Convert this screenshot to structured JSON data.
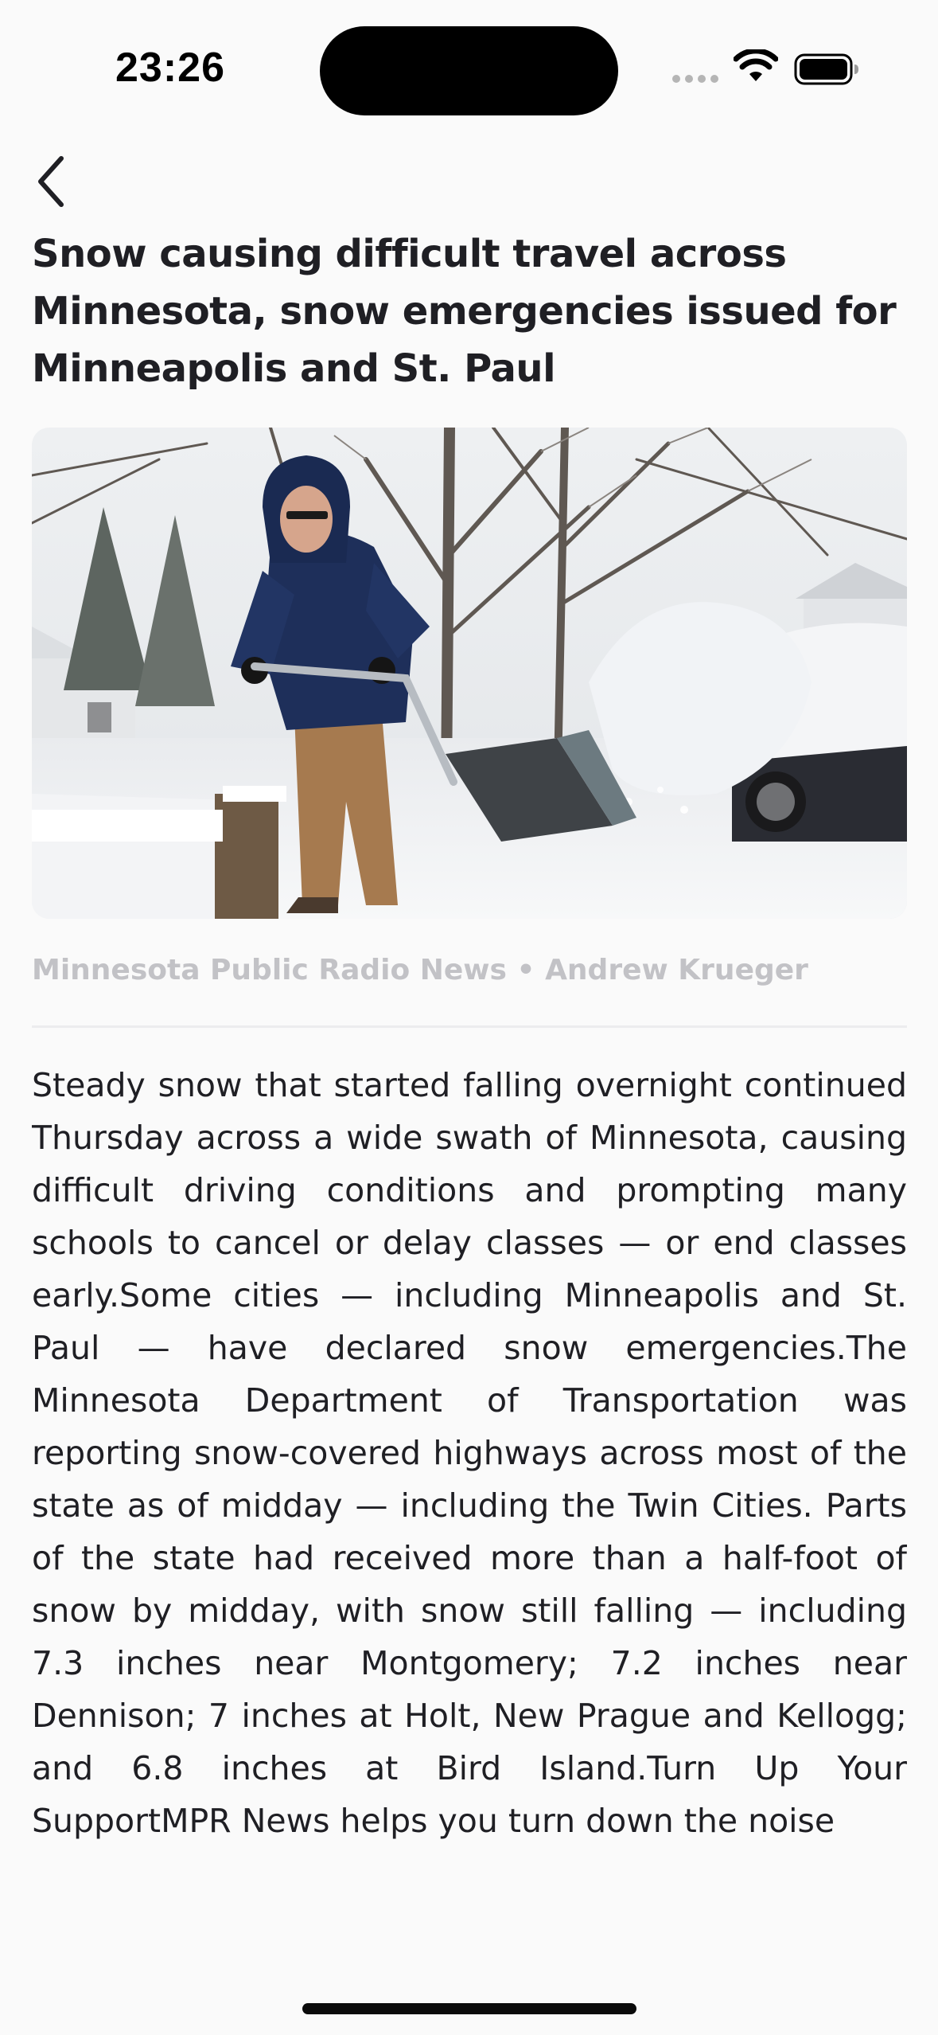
{
  "status_bar": {
    "time": "23:26",
    "icons": [
      "signal-dots-icon",
      "wifi-icon",
      "battery-icon"
    ]
  },
  "nav": {
    "back_icon": "chevron-left-icon"
  },
  "article": {
    "headline": "Snow causing difficult travel across Minnesota, snow emergencies issued for Minneapolis and St. Paul",
    "image_description": "Person in blue winter coat shoveling snow on a residential street",
    "byline": "Minnesota Public Radio News • Andrew Krueger",
    "body": "Steady snow that started falling overnight continued Thursday across a wide swath of Minnesota, causing difficult driving conditions and prompting many schools to cancel or delay classes — or end classes early.Some cities — including Minneapolis and St. Paul — have declared snow emergencies.The Minnesota Department of Transportation was reporting snow-covered highways across most of the state as of midday — including the Twin Cities. Parts of the state had received more than a half-foot of snow by midday, with snow still falling — including 7.3 inches near Montgomery; 7.2 inches near Dennison; 7 inches at Holt, New Prague and Kellogg; and 6.8 inches at Bird Island.Turn Up Your SupportMPR News helps you turn down the noise"
  },
  "colors": {
    "background": "#fafafa",
    "text": "#1f1f24",
    "byline": "#c2c2c6",
    "divider": "#ececee"
  }
}
